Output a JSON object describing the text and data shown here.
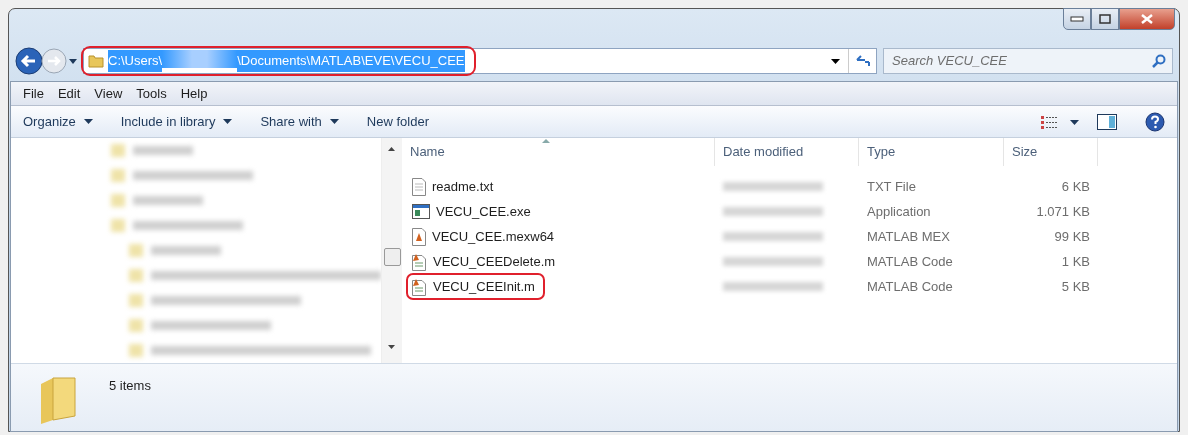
{
  "address": {
    "parts": [
      "C:\\Users\\",
      "\\Documents\\MATLAB\\EVE\\VECU_CEE"
    ],
    "selected": true,
    "highlighted": true
  },
  "search": {
    "placeholder": "Search VECU_CEE"
  },
  "menu": [
    "File",
    "Edit",
    "View",
    "Tools",
    "Help"
  ],
  "toolbar": [
    {
      "label": "Organize",
      "dropdown": true
    },
    {
      "label": "Include in library",
      "dropdown": true
    },
    {
      "label": "Share with",
      "dropdown": true
    },
    {
      "label": "New folder",
      "dropdown": false
    }
  ],
  "columns": [
    {
      "label": "Name",
      "sorted": true
    },
    {
      "label": "Date modified",
      "sorted": false
    },
    {
      "label": "Type",
      "sorted": false
    },
    {
      "label": "Size",
      "sorted": false
    }
  ],
  "files": [
    {
      "name": "readme.txt",
      "kind": "text",
      "type": "TXT File",
      "size": "6 KB",
      "highlighted": false
    },
    {
      "name": "VECU_CEE.exe",
      "kind": "exe",
      "type": "Application",
      "size": "1.071 KB",
      "highlighted": false
    },
    {
      "name": "VECU_CEE.mexw64",
      "kind": "mex",
      "type": "MATLAB MEX",
      "size": "99 KB",
      "highlighted": false
    },
    {
      "name": "VECU_CEEDelete.m",
      "kind": "mcode",
      "type": "MATLAB Code",
      "size": "1 KB",
      "highlighted": false
    },
    {
      "name": "VECU_CEEInit.m",
      "kind": "mcode",
      "type": "MATLAB Code",
      "size": "5 KB",
      "highlighted": true
    }
  ],
  "status": {
    "count": "5 items"
  }
}
